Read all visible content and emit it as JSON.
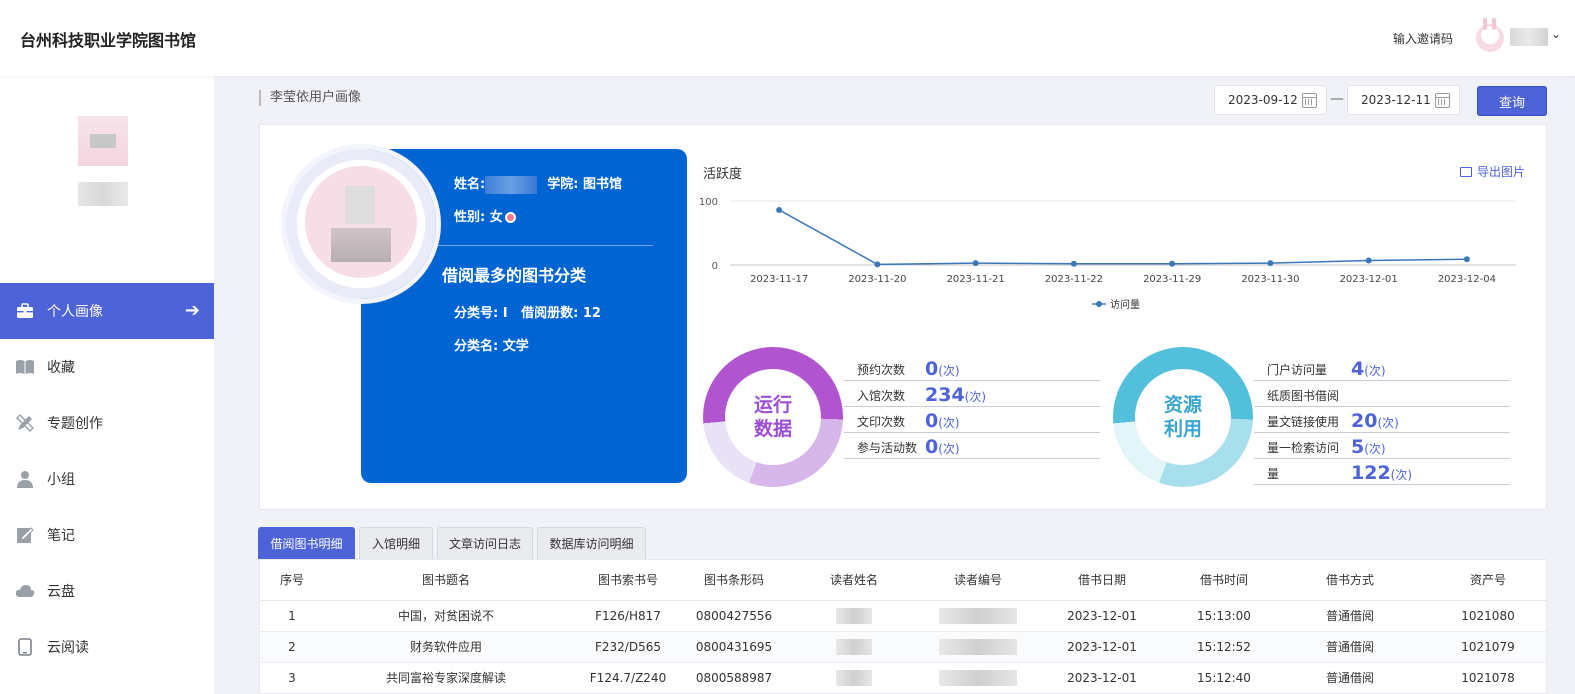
{
  "header": {
    "brand": "台州科技职业学院图书馆",
    "invite_label": "输入邀请码",
    "caret": "⌄"
  },
  "sidebar": {
    "items": [
      {
        "label": "个人画像",
        "icon": "briefcase-icon",
        "active": true
      },
      {
        "label": "收藏",
        "icon": "book-icon"
      },
      {
        "label": "专题创作",
        "icon": "pencil-ruler-icon"
      },
      {
        "label": "小组",
        "icon": "user-icon"
      },
      {
        "label": "笔记",
        "icon": "note-icon"
      },
      {
        "label": "云盘",
        "icon": "cloud-icon"
      },
      {
        "label": "云阅读",
        "icon": "tablet-icon"
      }
    ],
    "arrow": "➔"
  },
  "toolbar": {
    "breadcrumb": "李莹依用户画像",
    "date_start": "2023-09-12",
    "date_sep": "—",
    "date_end": "2023-12-11",
    "query_label": "查询"
  },
  "profile": {
    "name_label": "姓名:",
    "college_label": "学院:",
    "college_value": "图书馆",
    "gender_label": "性别:",
    "gender_value": "女",
    "top_category_title": "借阅最多的图书分类",
    "category_code_label": "分类号:",
    "category_code": "I",
    "borrow_count_label": "借阅册数:",
    "borrow_count": "12",
    "category_name_label": "分类名:",
    "category_name": "文学"
  },
  "activity": {
    "title": "活跃度",
    "export_label": "导出图片"
  },
  "chart_data": {
    "type": "line",
    "title": "活跃度",
    "categories": [
      "2023-11-17",
      "2023-11-20",
      "2023-11-21",
      "2023-11-22",
      "2023-11-29",
      "2023-11-30",
      "2023-12-01",
      "2023-12-04"
    ],
    "series": [
      {
        "name": "访问量",
        "values": [
          86,
          1,
          3,
          2,
          2,
          3,
          7,
          9
        ]
      }
    ],
    "yticks": [
      "100",
      "0"
    ],
    "ylim": [
      0,
      100
    ],
    "grid": true,
    "legend": "bottom-center",
    "color": "#3a78b8"
  },
  "operations": {
    "center_line1": "运行",
    "center_line2": "数据",
    "rows": [
      {
        "label": "预约次数",
        "value": "0",
        "unit": "(次)"
      },
      {
        "label": "入馆次数",
        "value": "234",
        "unit": "(次)"
      },
      {
        "label": "文印次数",
        "value": "0",
        "unit": "(次)"
      },
      {
        "label": "参与活动数",
        "value": "0",
        "unit": "(次)"
      }
    ]
  },
  "resources": {
    "center_line1": "资源",
    "center_line2": "利用",
    "rows": [
      {
        "label": "门户访问量",
        "value": "4",
        "unit": "(次)"
      },
      {
        "label": "纸质图书借阅",
        "value": "",
        "unit": ""
      },
      {
        "label": "量文链接使用",
        "value": "20",
        "unit": "(次)"
      },
      {
        "label": "量一检索访问",
        "value": "5",
        "unit": "(次)"
      },
      {
        "label": "量",
        "value": "122",
        "unit": "(次)"
      }
    ]
  },
  "tabs": [
    {
      "label": "借阅图书明细",
      "active": true
    },
    {
      "label": "入馆明细"
    },
    {
      "label": "文章访问日志"
    },
    {
      "label": "数据库访问明细"
    }
  ],
  "table": {
    "headers": [
      "序号",
      "图书题名",
      "图书索书号",
      "图书条形码",
      "读者姓名",
      "读者编号",
      "借书日期",
      "借书时间",
      "借书方式",
      "资产号"
    ],
    "rows": [
      [
        "1",
        "中国，对贫困说不",
        "F126/H817",
        "0800427556",
        "",
        "",
        "2023-12-01",
        "15:13:00",
        "普通借阅",
        "1021080"
      ],
      [
        "2",
        "财务软件应用",
        "F232/D565",
        "0800431695",
        "",
        "",
        "2023-12-01",
        "15:12:52",
        "普通借阅",
        "1021079"
      ],
      [
        "3",
        "共同富裕专家深度解读",
        "F124.7/Z240",
        "0800588987",
        "",
        "",
        "2023-12-01",
        "15:12:40",
        "普通借阅",
        "1021078"
      ]
    ]
  },
  "colors": {
    "accent": "#4f63d9",
    "card": "#0064d2",
    "ops": "#b055cf",
    "res": "#52bfdb"
  }
}
